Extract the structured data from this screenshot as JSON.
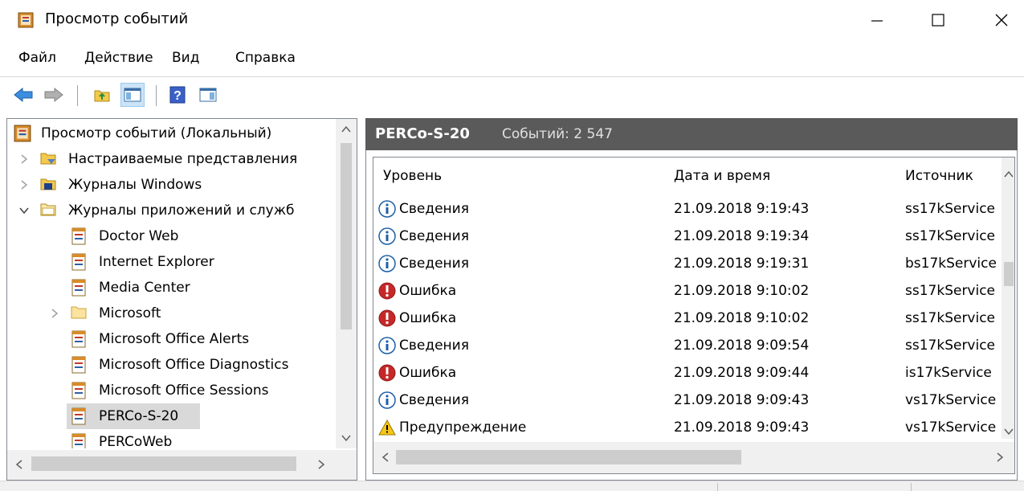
{
  "window": {
    "title": "Просмотр событий",
    "minimize_label": "—",
    "maximize_label": "☐",
    "close_label": "✕"
  },
  "menu": [
    "Файл",
    "Действие",
    "Вид",
    "Справка"
  ],
  "toolbar": {
    "buttons": [
      "back-icon",
      "forward-icon",
      "up-folder-icon",
      "show-hide-tree-icon",
      "help-icon",
      "show-hide-action-pane-icon"
    ]
  },
  "tree": {
    "root": "Просмотр событий (Локальный)",
    "items": [
      {
        "label": "Настраиваемые представления",
        "icon": "custom-views-icon"
      },
      {
        "label": "Журналы Windows",
        "icon": "windows-logs-icon"
      },
      {
        "label": "Журналы приложений и служб",
        "icon": "folder-icon"
      },
      {
        "label": "Doctor Web",
        "icon": "log-icon"
      },
      {
        "label": "Internet Explorer",
        "icon": "log-icon"
      },
      {
        "label": "Media Center",
        "icon": "log-icon"
      },
      {
        "label": "Microsoft",
        "icon": "folder-icon"
      },
      {
        "label": "Microsoft Office Alerts",
        "icon": "log-icon"
      },
      {
        "label": "Microsoft Office Diagnostics",
        "icon": "log-icon"
      },
      {
        "label": "Microsoft Office Sessions",
        "icon": "log-icon"
      },
      {
        "label": "PERCo-S-20",
        "icon": "log-icon"
      },
      {
        "label": "PERCoWeb",
        "icon": "log-icon"
      }
    ]
  },
  "right_header": {
    "title": "PERCo-S-20",
    "count": "Событий: 2 547"
  },
  "events": {
    "columns": [
      "Уровень",
      "Дата и время",
      "Источник"
    ],
    "rows": [
      {
        "level": "Сведения",
        "type": "info",
        "datetime": "21.09.2018 9:19:43",
        "source": "ss17kService"
      },
      {
        "level": "Сведения",
        "type": "info",
        "datetime": "21.09.2018 9:19:34",
        "source": "ss17kService"
      },
      {
        "level": "Сведения",
        "type": "info",
        "datetime": "21.09.2018 9:19:31",
        "source": "bs17kService"
      },
      {
        "level": "Ошибка",
        "type": "error",
        "datetime": "21.09.2018 9:10:02",
        "source": "ss17kService"
      },
      {
        "level": "Ошибка",
        "type": "error",
        "datetime": "21.09.2018 9:10:02",
        "source": "ss17kService"
      },
      {
        "level": "Сведения",
        "type": "info",
        "datetime": "21.09.2018 9:09:54",
        "source": "ss17kService"
      },
      {
        "level": "Ошибка",
        "type": "error",
        "datetime": "21.09.2018 9:09:44",
        "source": "is17kService"
      },
      {
        "level": "Сведения",
        "type": "info",
        "datetime": "21.09.2018 9:09:43",
        "source": "vs17kService"
      },
      {
        "level": "Предупреждение",
        "type": "warning",
        "datetime": "21.09.2018 9:09:43",
        "source": "vs17kService"
      }
    ]
  },
  "colors": {
    "header_bg": "#5a5a5a",
    "info": "#1c5fa8",
    "error": "#c62828",
    "warning": "#f5c518"
  }
}
